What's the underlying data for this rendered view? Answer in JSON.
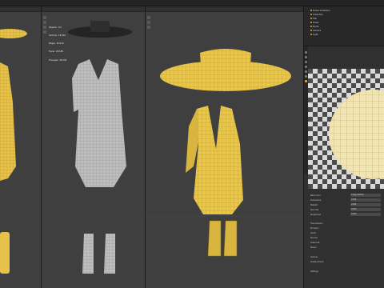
{
  "window": {
    "title": "Blender [C:\\Users\\...\\hat_dress_boots.blend]"
  },
  "viewports": {
    "left": {
      "label": "User Perspective"
    },
    "middle": {
      "label": "User Perspective",
      "stats": [
        "Objects  1/4",
        "Vertices  18,432",
        "Edges  36,610",
        "Faces  18,180",
        "Triangles  36,204"
      ]
    },
    "center": {
      "label": "User Perspective"
    }
  },
  "outliner": {
    "items": [
      "Scene Collection",
      "Collection",
      "Hat",
      "Dress",
      "Boots",
      "Camera",
      "Light"
    ]
  },
  "properties": {
    "rows": [
      {
        "label": "Base Color",
        "value": "Image Texture"
      },
      {
        "label": "Subsurface",
        "value": "0.000"
      },
      {
        "label": "Metallic",
        "value": "0.000"
      },
      {
        "label": "Specular",
        "value": "0.500"
      },
      {
        "label": "Roughness",
        "value": "0.500"
      }
    ],
    "sections": [
      "Transmission",
      "Emission",
      "Alpha",
      "Normal",
      "Clearcoat",
      "Sheen",
      "Volume",
      "Displacement",
      "Settings"
    ]
  },
  "colors": {
    "viewport_bg": "#3f3f3f",
    "accent": "#e8a23a",
    "fabric": "#e6c24a",
    "mesh_grey": "#bdbdbd"
  }
}
